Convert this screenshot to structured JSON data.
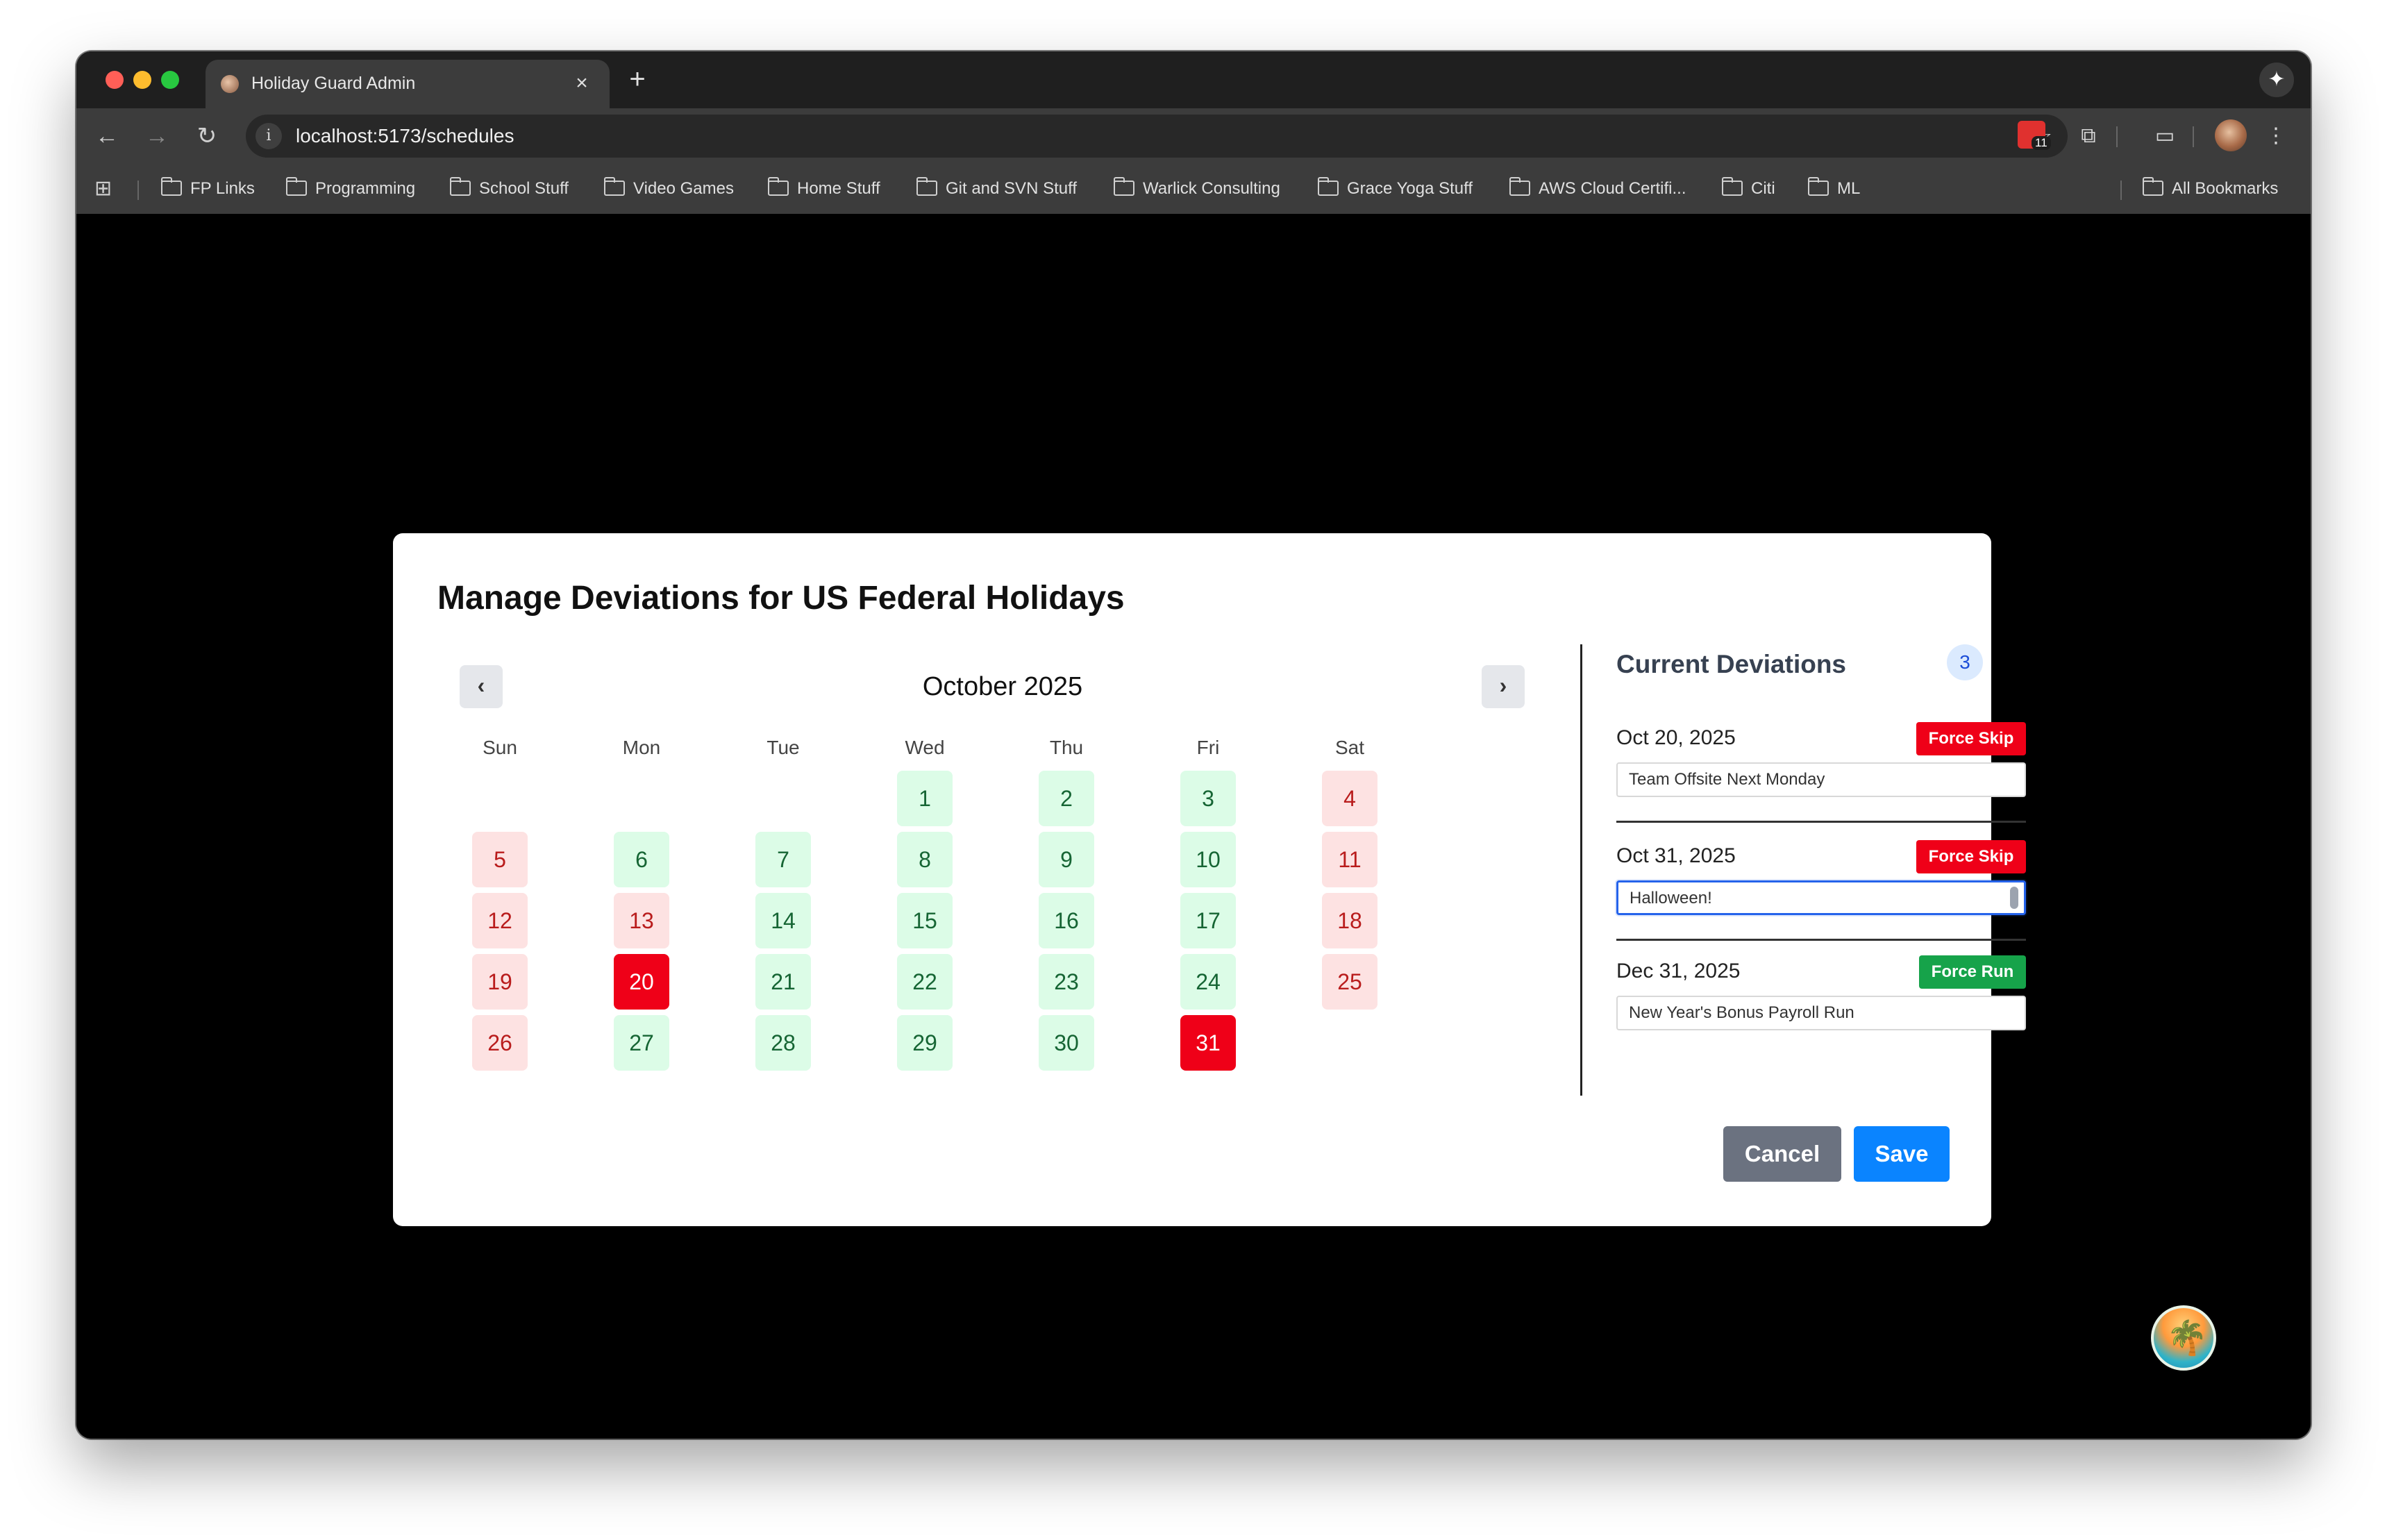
{
  "browser": {
    "tab_title": "Holiday Guard Admin",
    "tab_close": "×",
    "new_tab": "+",
    "url": "localhost:5173/schedules",
    "extension_count": "11",
    "bookmarks": [
      "FP Links",
      "Programming",
      "School Stuff",
      "Video Games",
      "Home Stuff",
      "Git and SVN Stuff",
      "Warlick Consulting",
      "Grace Yoga Stuff",
      "AWS Cloud Certifi...",
      "Citi",
      "ML"
    ],
    "all_bookmarks": "All Bookmarks"
  },
  "modal": {
    "title": "Manage Deviations for US Federal Holidays",
    "calendar": {
      "month_label": "October 2025",
      "prev": "‹",
      "next": "›",
      "weekdays": [
        "Sun",
        "Mon",
        "Tue",
        "Wed",
        "Thu",
        "Fri",
        "Sat"
      ],
      "first_weekday_index": 3,
      "days_in_month": 31,
      "day_status": {
        "1": "green",
        "2": "green",
        "3": "green",
        "4": "pink",
        "5": "pink",
        "6": "green",
        "7": "green",
        "8": "green",
        "9": "green",
        "10": "green",
        "11": "pink",
        "12": "pink",
        "13": "pink",
        "14": "green",
        "15": "green",
        "16": "green",
        "17": "green",
        "18": "pink",
        "19": "pink",
        "20": "red",
        "21": "green",
        "22": "green",
        "23": "green",
        "24": "green",
        "25": "pink",
        "26": "pink",
        "27": "green",
        "28": "green",
        "29": "green",
        "30": "green",
        "31": "red"
      },
      "colors": {
        "green_bg": "#dcfce7",
        "green_text": "#166534",
        "pink_bg": "#fde2e2",
        "pink_text": "#b91c1c",
        "red_bg": "#ef0018",
        "red_text": "#ffffff"
      }
    },
    "deviations": {
      "header": "Current Deviations",
      "count": "3",
      "items": [
        {
          "date": "Oct 20, 2025",
          "type": "Force Skip",
          "note": "Team Offsite Next Monday"
        },
        {
          "date": "Oct 31, 2025",
          "type": "Force Skip",
          "note": "Halloween!"
        },
        {
          "date": "Dec 31, 2025",
          "type": "Force Run",
          "note": "New Year's Bonus Payroll Run"
        }
      ]
    },
    "buttons": {
      "cancel": "Cancel",
      "save": "Save"
    }
  },
  "icons": {
    "back": "arrow-left-icon",
    "forward": "arrow-right-icon",
    "reload": "reload-icon",
    "site_info": "info-icon",
    "bookmark_star": "star-icon",
    "extensions": "puzzle-icon",
    "apps": "apps-grid-icon",
    "menu": "kebab-menu-icon",
    "gemini": "sparkle-icon",
    "floating_app": "palm-island-logo-icon"
  }
}
